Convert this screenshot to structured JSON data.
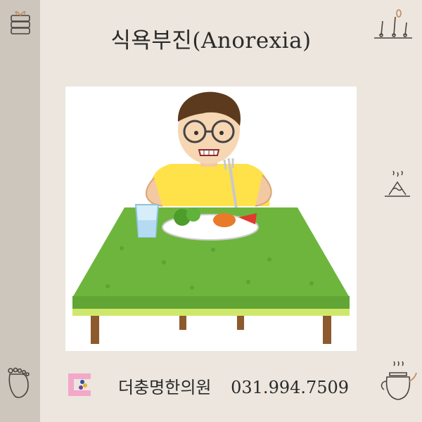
{
  "header": {
    "title": "식욕부진(Anorexia)"
  },
  "illustration": {
    "subject": "boy-refusing-food-at-table",
    "colors": {
      "tablecloth": "#6eb53d",
      "shirt": "#ffe14a",
      "background": "#ffffff"
    }
  },
  "footer": {
    "clinic_name": "더충명한의원",
    "phone": "031.994.7509"
  },
  "icons": {
    "top_left": "stacked-gift-icon",
    "top_right": "acupuncture-needles-icon",
    "mid_right": "steaming-herb-icon",
    "bottom_left": "foot-icon",
    "bottom_right": "teapot-icon",
    "logo": "clinic-logo-icon"
  },
  "colors": {
    "background": "#ece6de",
    "side_strip": "#cdc6bd",
    "accent": "#c08a5a"
  }
}
